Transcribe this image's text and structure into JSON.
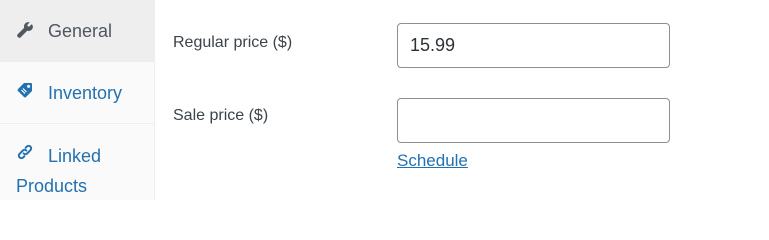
{
  "tabs": [
    {
      "label": "General",
      "icon": "wrench-icon",
      "active": true
    },
    {
      "label": "Inventory",
      "icon": "tag-icon",
      "active": false
    },
    {
      "label": "Linked Products",
      "icon": "link-icon",
      "active": false
    }
  ],
  "fields": {
    "regular_price": {
      "label": "Regular price ($)",
      "value": "15.99",
      "placeholder": ""
    },
    "sale_price": {
      "label": "Sale price ($)",
      "value": "",
      "placeholder": ""
    },
    "schedule_link": "Schedule"
  },
  "colors": {
    "link": "#2271b1",
    "active_tab_bg": "#eeeeee",
    "sidebar_bg": "#fafafa",
    "input_border": "#8c8f94"
  }
}
